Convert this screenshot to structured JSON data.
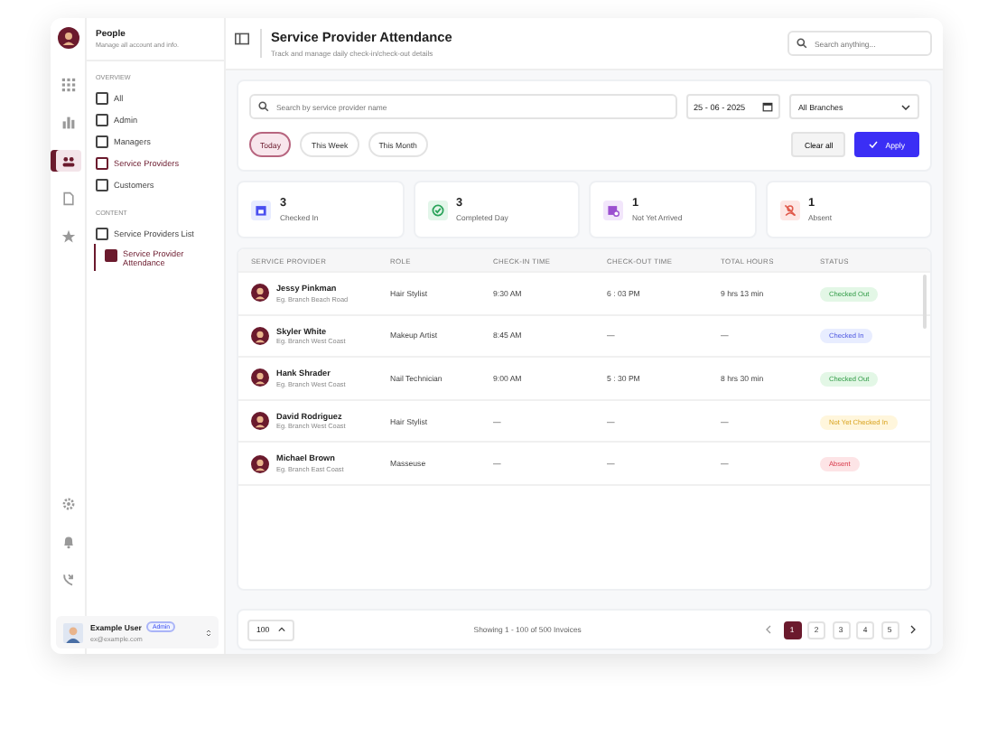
{
  "app": {
    "name": "People",
    "subtitle": "Manage all account and info."
  },
  "rail": {
    "top": [
      {
        "selected": false
      },
      {
        "selected": false
      },
      {
        "selected": true
      },
      {
        "selected": false
      },
      {
        "selected": false
      }
    ],
    "bottom": [
      {
        "selected": false
      },
      {
        "selected": false
      },
      {
        "selected": false
      }
    ]
  },
  "sidebar": {
    "sections": [
      {
        "heading": "OVERVIEW",
        "items": [
          {
            "label": "All",
            "selected": false
          },
          {
            "label": "Admin",
            "selected": false
          },
          {
            "label": "Managers",
            "selected": false
          },
          {
            "label": "Service Providers",
            "selected": true
          },
          {
            "label": "Customers",
            "selected": false
          }
        ]
      },
      {
        "heading": "CONTENT",
        "items": [
          {
            "label": "Service Providers List",
            "selected": false,
            "children": [
              {
                "label": "Service Provider Attendance",
                "selected": true
              }
            ]
          }
        ]
      }
    ]
  },
  "user": {
    "name": "Example User",
    "badge": "Admin",
    "email": "ex@example.com"
  },
  "header": {
    "title": "Service Provider Attendance",
    "subtitle": "Track and manage daily check-in/check-out details",
    "search": {
      "placeholder": "Search anything..."
    }
  },
  "filters": {
    "search": {
      "placeholder": "Search by service provider name"
    },
    "date": "25 - 06 - 2025",
    "branch": "All Branches",
    "periods": [
      {
        "label": "Today",
        "selected": true
      },
      {
        "label": "This Week",
        "selected": false
      },
      {
        "label": "This Month",
        "selected": false
      }
    ],
    "clear_label": "Clear all",
    "apply_label": "Apply"
  },
  "stats": [
    {
      "value": "3",
      "label": "Checked In",
      "kind": "checked_in"
    },
    {
      "value": "3",
      "label": "Completed Day",
      "kind": "completed"
    },
    {
      "value": "1",
      "label": "Not Yet Arrived",
      "kind": "not_arrived"
    },
    {
      "value": "1",
      "label": "Absent",
      "kind": "absent"
    }
  ],
  "table": {
    "columns": [
      "SERVICE PROVIDER",
      "ROLE",
      "CHECK-IN TIME",
      "CHECK-OUT TIME",
      "TOTAL HOURS",
      "STATUS"
    ],
    "rows": [
      {
        "name": "Jessy Pinkman",
        "branch": "Eg. Branch Beach Road",
        "role": "Hair Stylist",
        "check_in": "9:30 AM",
        "check_out": "6 : 03 PM",
        "total": "9 hrs 13 min",
        "status": {
          "label": "Checked Out",
          "kind": "checked_out"
        }
      },
      {
        "name": "Skyler White",
        "branch": "Eg. Branch West Coast",
        "role": "Makeup Artist",
        "check_in": "8:45 AM",
        "check_out": "—",
        "total": "—",
        "status": {
          "label": "Checked In",
          "kind": "checked_in"
        }
      },
      {
        "name": "Hank Shrader",
        "branch": "Eg. Branch West Coast",
        "role": "Nail Technician",
        "check_in": "9:00 AM",
        "check_out": "5 : 30 PM",
        "total": "8 hrs 30 min",
        "status": {
          "label": "Checked Out",
          "kind": "checked_out"
        }
      },
      {
        "name": "David Rodriguez",
        "branch": "Eg. Branch West Coast",
        "role": "Hair Stylist",
        "check_in": "—",
        "check_out": "—",
        "total": "—",
        "status": {
          "label": "Not Yet Checked In",
          "kind": "not_arrived"
        }
      },
      {
        "name": "Michael Brown",
        "branch": "Eg. Branch East Coast",
        "role": "Masseuse",
        "check_in": "—",
        "check_out": "—",
        "total": "—",
        "status": {
          "label": "Absent",
          "kind": "absent"
        }
      }
    ]
  },
  "footer": {
    "page_size": "100",
    "summary": "Showing 1 - 100 of 500 Invoices",
    "pages": [
      {
        "label": "1",
        "selected": true
      },
      {
        "label": "2",
        "selected": false
      },
      {
        "label": "3",
        "selected": false
      },
      {
        "label": "4",
        "selected": false
      },
      {
        "label": "5",
        "selected": false
      }
    ]
  }
}
